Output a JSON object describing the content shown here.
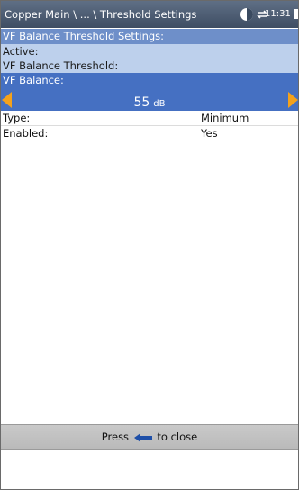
{
  "header": {
    "breadcrumb": "Copper Main \\ ... \\ Threshold Settings",
    "time": "11:31 AM"
  },
  "section": {
    "title": "VF Balance Threshold Settings:",
    "active_label": "Active:",
    "threshold_label": "VF Balance Threshold:"
  },
  "selector": {
    "label": "VF Balance:",
    "value": "55",
    "unit": "dB"
  },
  "properties": [
    {
      "key": "Type:",
      "value": "Minimum"
    },
    {
      "key": "Enabled:",
      "value": "Yes"
    }
  ],
  "hint": {
    "prefix": "Press",
    "suffix": "to close"
  },
  "colors": {
    "titlebar": "#4a5a70",
    "section_title": "#6e8fc9",
    "section_light": "#bdd0ec",
    "selector": "#4570c2",
    "arrow": "#f4a21c"
  },
  "icons": [
    "status-circle-icon",
    "sync-icon",
    "battery-icon",
    "left-arrow-icon",
    "right-arrow-icon",
    "back-arrow-icon"
  ]
}
